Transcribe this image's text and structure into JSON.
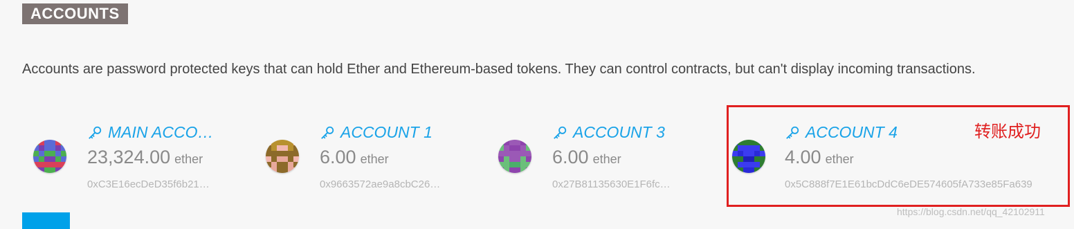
{
  "section": {
    "title": "ACCOUNTS",
    "description": "Accounts are password protected keys that can hold Ether and Ethereum-based tokens. They can control contracts, but can't display incoming transactions."
  },
  "accounts": [
    {
      "name": "MAIN ACCO…",
      "balance": "23,324.00",
      "unit": "ether",
      "address": "0xC3E16ecDeD35f6b21…",
      "icon": "key-icon",
      "identicon_colors": [
        "#7a3fb0",
        "#d9405a",
        "#4caf50",
        "#5b6bd6"
      ]
    },
    {
      "name": "ACCOUNT 1",
      "balance": "6.00",
      "unit": "ether",
      "address": "0x9663572ae9a8cbC26…",
      "icon": "key-icon",
      "identicon_colors": [
        "#b8912f",
        "#f2b8b0",
        "#8c6a2a",
        "#e8a89c"
      ]
    },
    {
      "name": "ACCOUNT 3",
      "balance": "6.00",
      "unit": "ether",
      "address": "0x27B81135630E1F6fc…",
      "icon": "key-icon",
      "identicon_colors": [
        "#4caf6a",
        "#9b59b6",
        "#6bbf7a",
        "#8e44ad"
      ]
    },
    {
      "name": "ACCOUNT 4",
      "balance": "4.00",
      "unit": "ether",
      "address": "0x5C888f7E1E61bcDdC6eDE574605fA733e85Fa639",
      "icon": "key-icon",
      "identicon_colors": [
        "#2a2ad8",
        "#3b3bf0",
        "#2e7d32",
        "#1f1fb8"
      ]
    }
  ],
  "annotation": {
    "text": "转账成功",
    "color": "#e02020"
  },
  "watermark": "https://blog.csdn.net/qq_42102911",
  "colors": {
    "accent": "#1aa3e8",
    "title_bg": "#7d7372",
    "button": "#00a1e9"
  }
}
